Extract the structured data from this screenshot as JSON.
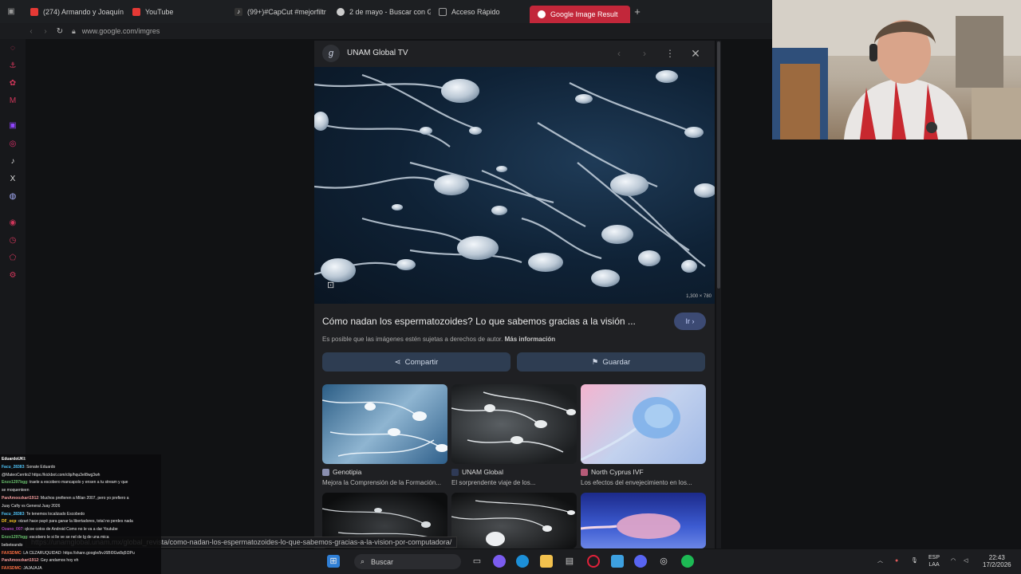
{
  "browser": {
    "tabs": [
      {
        "label": "(274) Armando y Joaquín",
        "favicon_color": "#e53935"
      },
      {
        "label": "YouTube",
        "favicon_color": "#e53935"
      },
      {
        "label": "(99+)#CapCut #mejorfiltr",
        "favicon_color": "#eeeeee"
      },
      {
        "label": "2 de mayo - Buscar con G",
        "favicon_color": "#cccccc"
      },
      {
        "label": "Acceso Rápido",
        "favicon_color": "#9e9e9e"
      },
      {
        "label": "Google Image Result",
        "favicon_color": "#ffffff",
        "active": true
      }
    ],
    "url": "www.google.com/imgres",
    "status_url": "https://unamglobal.unam.mx/global_revista/como-nadan-los-espermatozoides-lo-que-sabemos-gracias-a-la-vision-por-computadora/"
  },
  "viewer": {
    "source_name": "UNAM Global TV",
    "source_initial": "g",
    "image_dims": "1,300 × 780",
    "title": "Cómo nadan los espermatozoides? Lo que sabemos gracias a la visión ...",
    "go_label": "Ir",
    "copyright_text": "Es posible que las imágenes estén sujetas a derechos de autor.",
    "more_info": "Más información",
    "share_label": "Compartir",
    "save_label": "Guardar",
    "related": [
      {
        "source": "Genotipia",
        "caption": "Mejora la Comprensión de la Formación..."
      },
      {
        "source": "UNAM Global",
        "caption": "El sorprendente viaje de los..."
      },
      {
        "source": "North Cyprus IVF",
        "caption": "Los efectos del envejecimiento en los..."
      },
      {
        "source": "",
        "caption": ""
      },
      {
        "source": "",
        "caption": ""
      },
      {
        "source": "",
        "caption": ""
      }
    ]
  },
  "chat": [
    {
      "user": "EduardoUKI:",
      "msg": "",
      "color": "#ffffff"
    },
    {
      "user": "Facu_28383",
      "msg": ": Sonate Eduardo",
      "color": "#4fc3f7"
    },
    {
      "user": "",
      "msg": "@MateoCerrito2 https://kickbot.com/clip/hqu3eI8wg3wh",
      "color": "#ff5252"
    },
    {
      "user": "Enzo1297bgg",
      "msg": ": traele a escobero mancapolo y ensen a tu stream y que",
      "color": "#66bb6a"
    },
    {
      "user": "",
      "msg": "se moquenteen",
      "color": "#ffffff"
    },
    {
      "user": "PanAmoozkart1912",
      "msg": ": Muchos prefieren a Milan 2007, pero yo prefiero a",
      "color": "#ef9a9a"
    },
    {
      "user": "",
      "msg": "Juay Cafiy vs General Juay 2026",
      "color": "#ffffff"
    },
    {
      "user": "Facu_28383",
      "msg": ": Te tenemos localizado Escobedo",
      "color": "#4fc3f7"
    },
    {
      "user": "DF_ocp",
      "msg": ": otzart hace payé para ganar la libertadores, total no perdes nada",
      "color": "#ffca28"
    },
    {
      "user": "Ozano_007",
      "msg": ": qlcoe cotos de Android Como no le va a dar Youtube",
      "color": "#ab47bc"
    },
    {
      "user": "Enzo1297bgg",
      "msg": ": escobero le si lle ve se nel de lg de una mica",
      "color": "#66bb6a"
    },
    {
      "user": "",
      "msg": "bebeteando",
      "color": "#ffffff"
    },
    {
      "user": "FAXSDMC",
      "msg": ": LA CEZARUQUIDAD: https://share.google/bvJ6BI0Gw8q5I3Pu",
      "color": "#ff7043"
    },
    {
      "user": "PanAmoozkart1912",
      "msg": ": Gey andamos hoy eh",
      "color": "#ef9a9a"
    },
    {
      "user": "FAXSDMC",
      "msg": ": JAJAJAJA",
      "color": "#ff7043"
    }
  ],
  "taskbar": {
    "search_label": "Buscar",
    "lang_top": "ESP",
    "lang_bottom": "LAA",
    "time": "22:43",
    "date": "17/2/2026"
  }
}
